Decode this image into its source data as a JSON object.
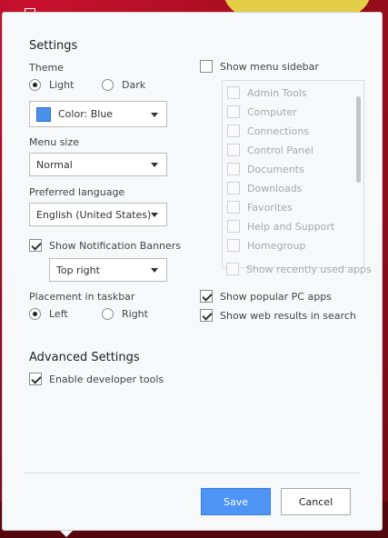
{
  "settings": {
    "title": "Settings",
    "theme_label": "Theme",
    "theme_options": [
      "Light",
      "Dark"
    ],
    "theme_selected": "Light",
    "color_value": "Color: Blue",
    "color_swatch": "#4a8fe8",
    "menu_size_label": "Menu size",
    "menu_size_value": "Normal",
    "language_label": "Preferred language",
    "language_value": "English (United States)",
    "notif_label": "Show Notification Banners",
    "notif_checked": true,
    "notif_position_value": "Top right",
    "taskbar_label": "Placement in taskbar",
    "taskbar_options": [
      "Left",
      "Right"
    ],
    "taskbar_selected": "Left"
  },
  "right": {
    "sidebar_label": "Show menu sidebar",
    "sidebar_items": [
      "Admin Tools",
      "Computer",
      "Connections",
      "Control Panel",
      "Documents",
      "Downloads",
      "Favorites",
      "Help and Support",
      "Homegroup"
    ],
    "recent_apps_label": "Show recently used apps",
    "popular_apps_label": "Show popular PC apps",
    "web_results_label": "Show web results in search"
  },
  "advanced": {
    "title": "Advanced Settings",
    "dev_tools_label": "Enable developer tools"
  },
  "footer": {
    "save_label": "Save",
    "cancel_label": "Cancel"
  }
}
